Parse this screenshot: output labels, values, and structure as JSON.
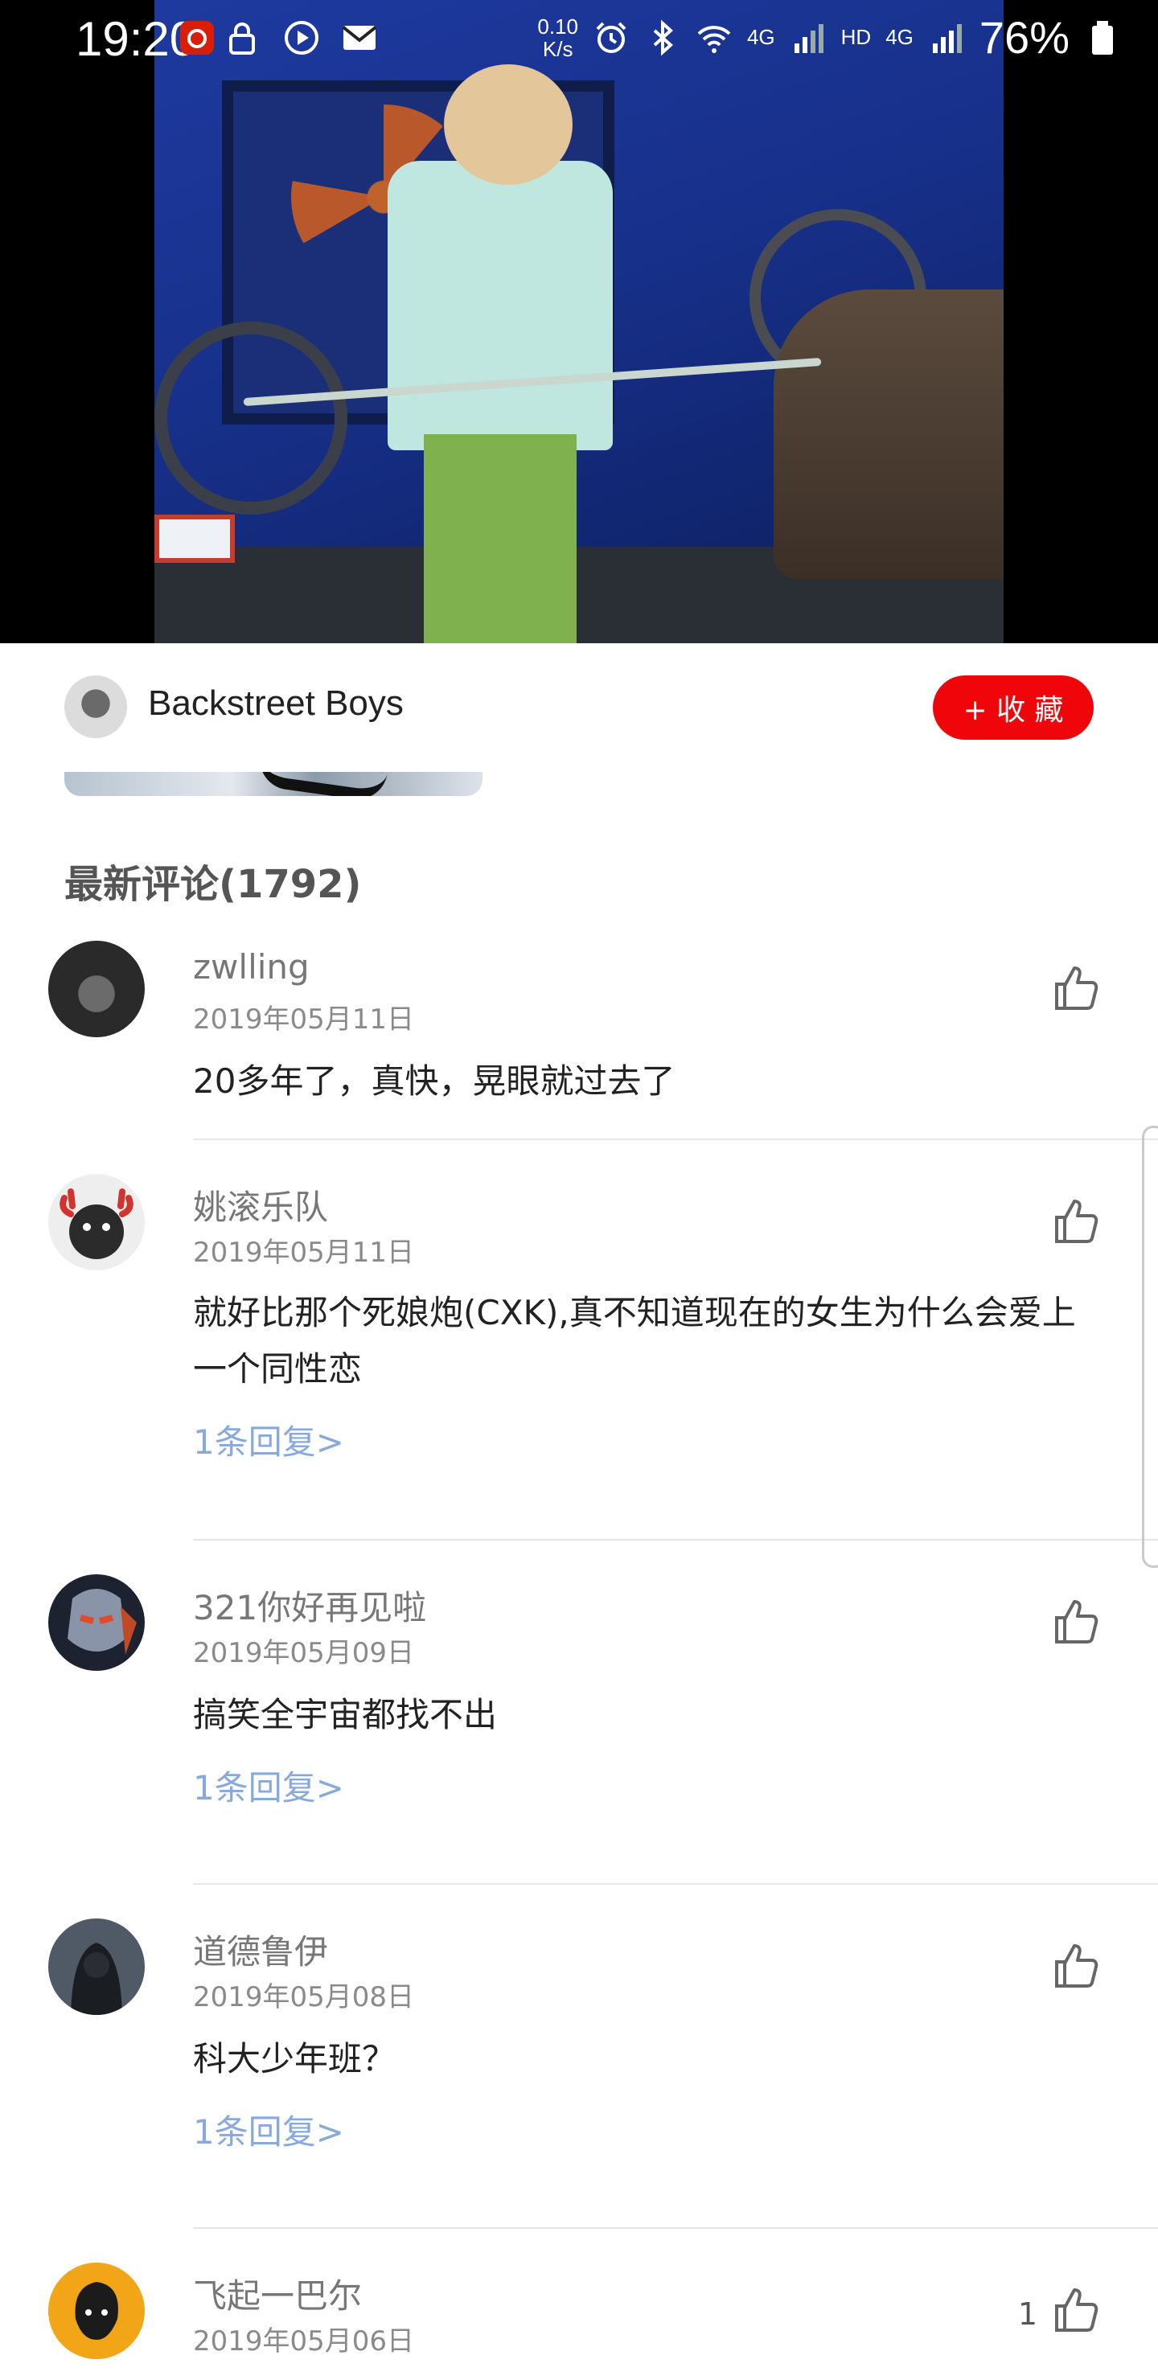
{
  "status_bar": {
    "time": "19:20",
    "net_speed_value": "0.10",
    "net_speed_unit": "K/s",
    "network_labels": [
      "4G",
      "HD",
      "4G"
    ],
    "battery_percent": "76%"
  },
  "artist": {
    "name": "Backstreet Boys",
    "follow_label": "+ 收 藏"
  },
  "comments_section": {
    "title": "最新评论(1792)",
    "items": [
      {
        "user": "zwlling",
        "date": "2019年05月11日",
        "text": "20多年了，真快，晃眼就过去了",
        "reply_label": "",
        "likes": ""
      },
      {
        "user": "姚滚乐队",
        "date": "2019年05月11日",
        "text": "就好比那个死娘炮(CXK),真不知道现在的女生为什么会爱上一个同性恋",
        "reply_label": "1条回复>",
        "likes": ""
      },
      {
        "user": "321你好再见啦",
        "date": "2019年05月09日",
        "text": "搞笑全宇宙都找不出",
        "reply_label": "1条回复>",
        "likes": ""
      },
      {
        "user": "道德鲁伊",
        "date": "2019年05月08日",
        "text": "科大少年班？",
        "reply_label": "1条回复>",
        "likes": ""
      },
      {
        "user": "飞起一巴尔",
        "date": "2019年05月06日",
        "text": "",
        "reply_label": "",
        "likes": "1"
      }
    ]
  },
  "colors": {
    "accent_red": "#f0060a",
    "reply_link": "#87a9dc"
  }
}
